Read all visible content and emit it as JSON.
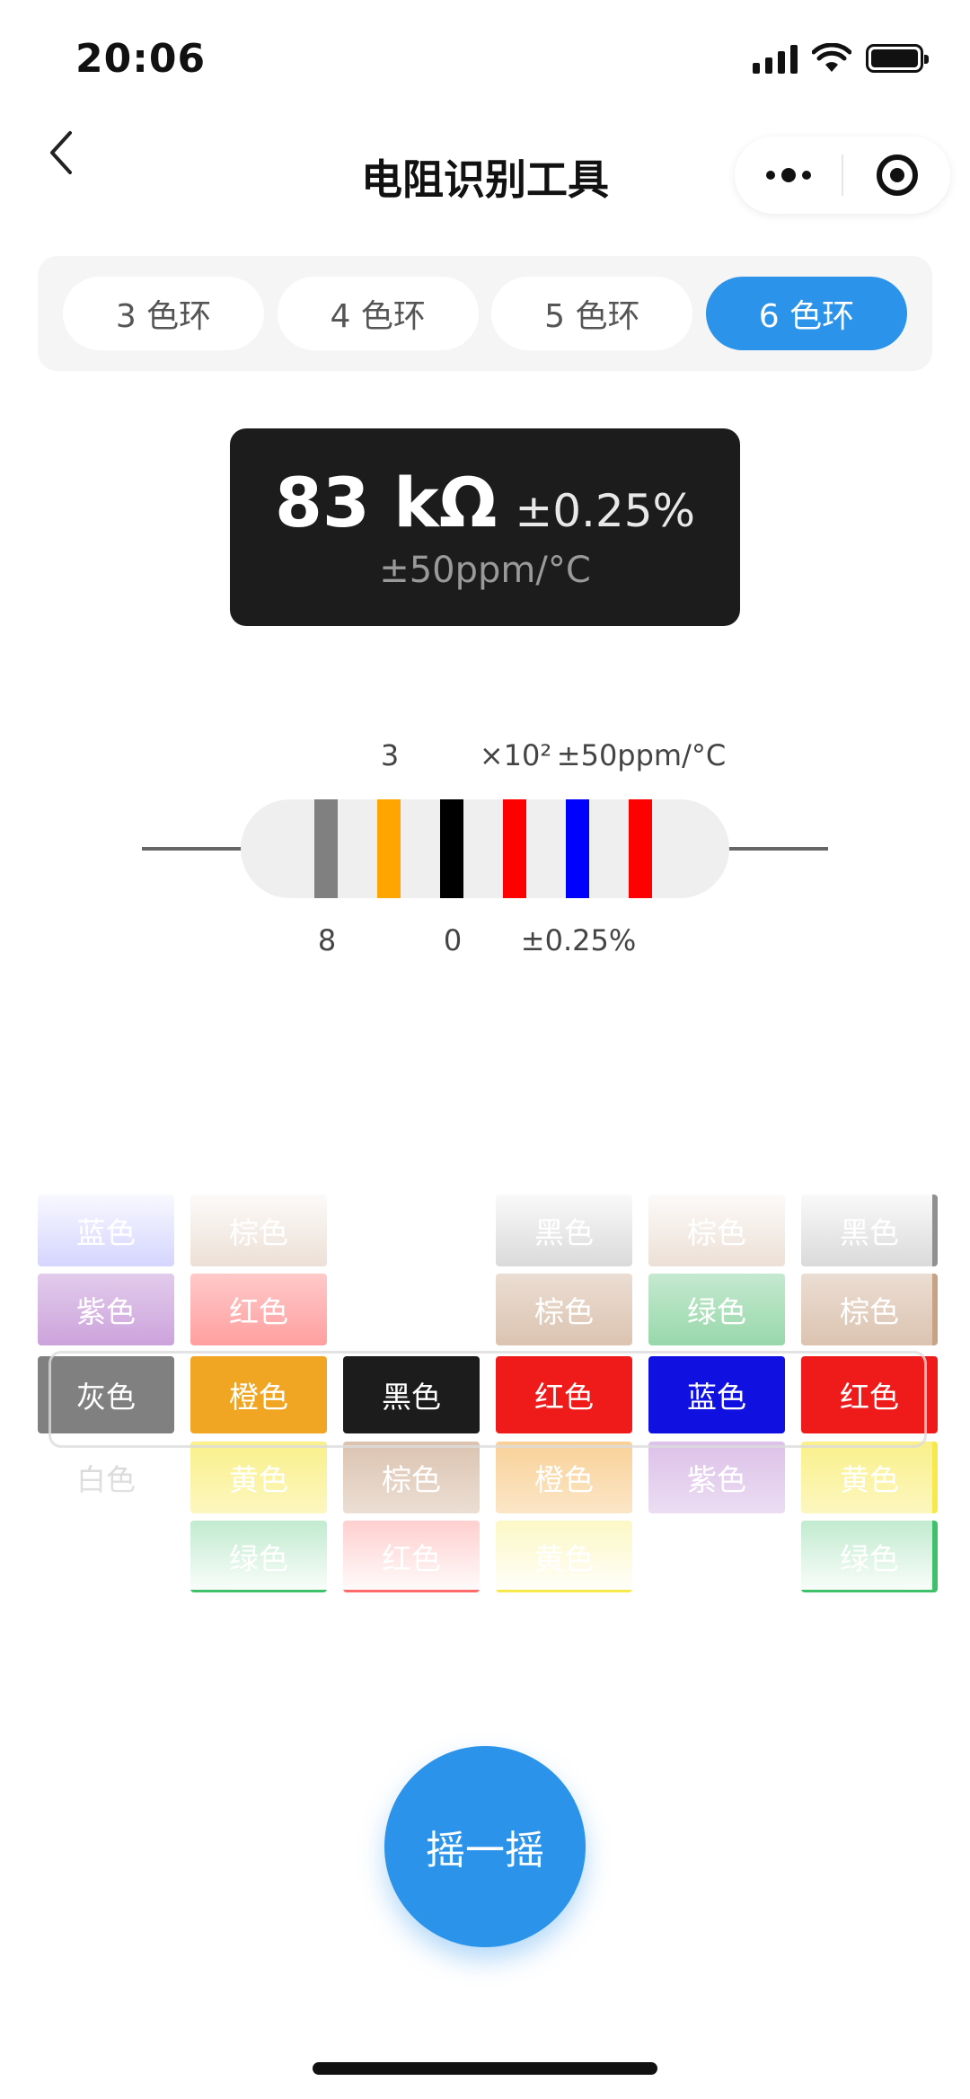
{
  "status_bar": {
    "time": "20:06"
  },
  "nav": {
    "title": "电阻识别工具"
  },
  "tabs": [
    {
      "label": "3 色环",
      "active": false
    },
    {
      "label": "4 色环",
      "active": false
    },
    {
      "label": "5 色环",
      "active": false
    },
    {
      "label": "6 色环",
      "active": true
    }
  ],
  "result": {
    "value": "83 kΩ",
    "tolerance": "±0.25%",
    "temp_coeff": "±50ppm/°C"
  },
  "resistor": {
    "labels_top": [
      "3",
      "×10²",
      "±50ppm/°C"
    ],
    "labels_bottom": [
      "8",
      "0",
      "±0.25%"
    ],
    "bands": [
      "#808080",
      "#ffa500",
      "#000000",
      "#ff0000",
      "#0000ff",
      "#ff0000"
    ]
  },
  "picker": {
    "columns": [
      {
        "items": [
          {
            "label": "蓝色",
            "color": "#8080ff"
          },
          {
            "label": "紫色",
            "color": "#b070c8"
          },
          {
            "label": "灰色",
            "color": "#808080"
          },
          {
            "label": "白色",
            "color": "#ffffff"
          }
        ]
      },
      {
        "items": [
          {
            "label": "棕色",
            "color": "#c8a285"
          },
          {
            "label": "红色",
            "color": "#ff6a6a"
          },
          {
            "label": "橙色",
            "color": "#f0a623"
          },
          {
            "label": "黄色",
            "color": "#f7e84b"
          },
          {
            "label": "绿色",
            "color": "#3fc06a"
          }
        ]
      },
      {
        "items": [
          {
            "label": "",
            "color": "#ffffff"
          },
          {
            "label": "",
            "color": "#ffffff"
          },
          {
            "label": "黑色",
            "color": "#1c1c1c"
          },
          {
            "label": "棕色",
            "color": "#c8a285"
          },
          {
            "label": "红色",
            "color": "#ff6a6a"
          }
        ]
      },
      {
        "items": [
          {
            "label": "黑色",
            "color": "#909090"
          },
          {
            "label": "棕色",
            "color": "#c8a285"
          },
          {
            "label": "红色",
            "color": "#ef1b1b"
          },
          {
            "label": "橙色",
            "color": "#f5b860"
          },
          {
            "label": "黄色",
            "color": "#f7e84b"
          }
        ]
      },
      {
        "items": [
          {
            "label": "棕色",
            "color": "#c8a285"
          },
          {
            "label": "绿色",
            "color": "#5fc27c"
          },
          {
            "label": "蓝色",
            "color": "#1010e0"
          },
          {
            "label": "紫色",
            "color": "#c99fdc"
          }
        ]
      },
      {
        "items": [
          {
            "label": "黑色",
            "color": "#909090"
          },
          {
            "label": "棕色",
            "color": "#c8a285"
          },
          {
            "label": "红色",
            "color": "#ef1b1b"
          },
          {
            "label": "黄色",
            "color": "#f7e84b"
          },
          {
            "label": "绿色",
            "color": "#3fc06a"
          }
        ]
      }
    ]
  },
  "shake_button": {
    "label": "摇一摇"
  }
}
